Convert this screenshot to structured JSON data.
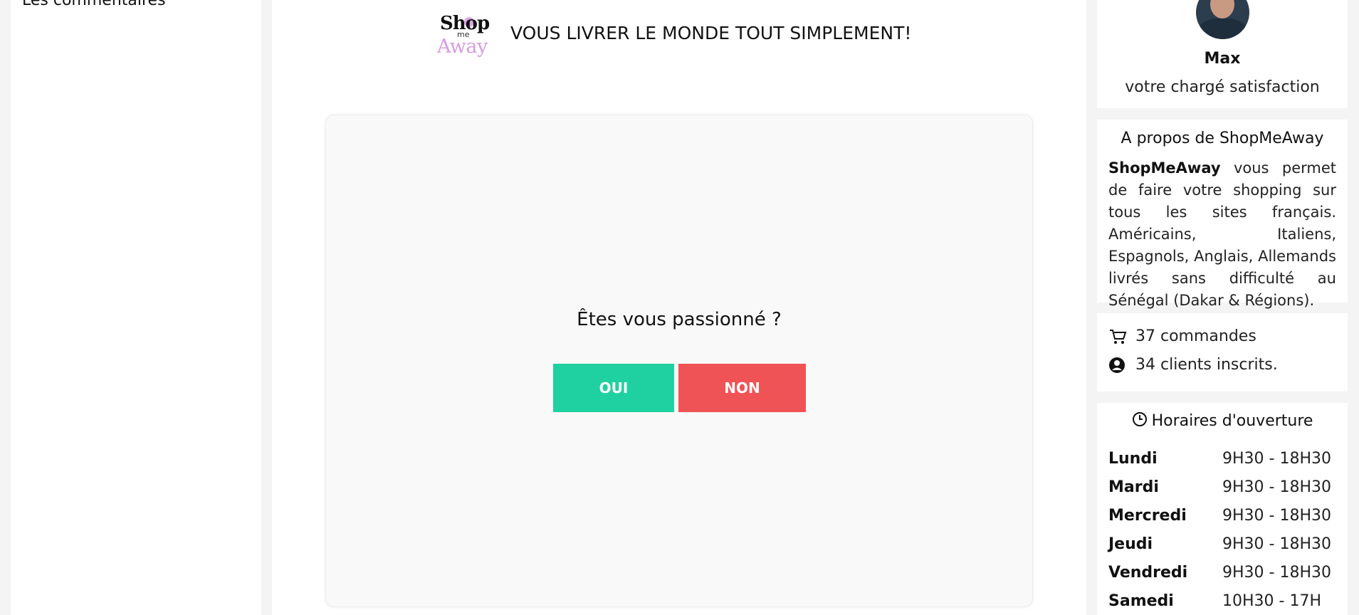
{
  "sidebar": {
    "cut_text": "Les commentaires"
  },
  "header": {
    "logo": {
      "shop": "Shop",
      "me": "me",
      "away": "Away"
    },
    "tagline": "VOUS LIVRER LE MONDE TOUT SIMPLEMENT!"
  },
  "quiz": {
    "question": "Êtes vous passionné ?",
    "yes_label": "OUI",
    "no_label": "NON",
    "colors": {
      "yes": "#1fd1a0",
      "no": "#f05355"
    }
  },
  "agent": {
    "name": "Max",
    "role": "votre chargé satisfaction"
  },
  "about": {
    "title": "A propos de ShopMeAway",
    "brand": "ShopMeAway",
    "text": " vous permet de faire votre shopping sur tous les sites français. Américains, Italiens, Espagnols, Anglais, Allemands livrés sans difficulté au Sénégal (Dakar & Régions)."
  },
  "stats": {
    "orders": "37 commandes",
    "clients": "34 clients inscrits.",
    "icons": {
      "orders": "cart-icon",
      "clients": "user-circle-icon"
    }
  },
  "hours": {
    "title": "Horaires d'ouverture",
    "icon": "clock-icon",
    "rows": [
      {
        "day": "Lundi",
        "time": "9H30 - 18H30"
      },
      {
        "day": "Mardi",
        "time": "9H30 - 18H30"
      },
      {
        "day": "Mercredi",
        "time": "9H30 - 18H30"
      },
      {
        "day": "Jeudi",
        "time": "9H30 - 18H30"
      },
      {
        "day": "Vendredi",
        "time": "9H30 - 18H30"
      },
      {
        "day": "Samedi",
        "time": "10H30 - 17H"
      }
    ]
  }
}
